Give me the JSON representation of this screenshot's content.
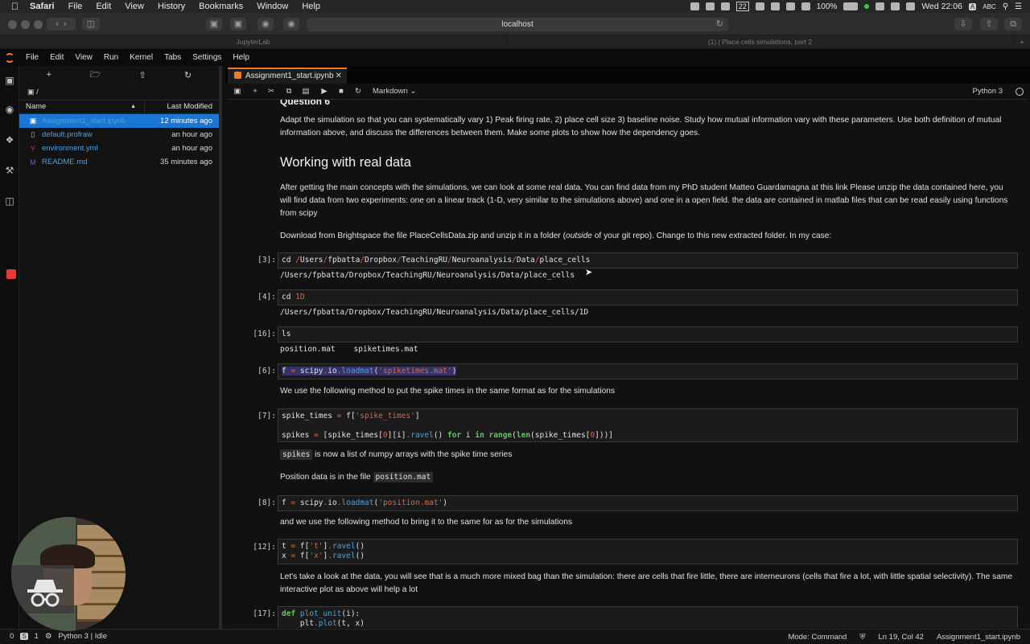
{
  "menubar": {
    "apple": "",
    "app": "Safari",
    "items": [
      "File",
      "Edit",
      "View",
      "History",
      "Bookmarks",
      "Window",
      "Help"
    ],
    "battery": "100%",
    "input_source": "ABC",
    "clock": "Wed 22:06",
    "calendar_day": "22"
  },
  "safari": {
    "address": "localhost",
    "tabs": [
      "JupyterLab",
      "(1) | Place cells simulations, part 2"
    ]
  },
  "jupyter_menu": [
    "File",
    "Edit",
    "View",
    "Run",
    "Kernel",
    "Tabs",
    "Settings",
    "Help"
  ],
  "file_browser": {
    "breadcrumb": "/",
    "col_name": "Name",
    "col_modified": "Last Modified",
    "files": [
      {
        "name": "Assignment1_start.ipynb",
        "modified": "12 minutes ago",
        "icon": "notebook-icon",
        "selected": true
      },
      {
        "name": "default.profraw",
        "modified": "an hour ago",
        "icon": "file-icon",
        "selected": false
      },
      {
        "name": "environment.yml",
        "modified": "an hour ago",
        "icon": "yaml-icon",
        "selected": false
      },
      {
        "name": "README.md",
        "modified": "35 minutes ago",
        "icon": "markdown-icon",
        "selected": false
      }
    ]
  },
  "notebook": {
    "tab_title": "Assignment1_start.ipynb",
    "cell_type": "Markdown",
    "kernel": "Python 3",
    "q6_heading": "Question 6",
    "q6_text": "Adapt the simulation so that you can systematically vary 1) Peak firing rate, 2) place cell size 3) baseline noise. Study how mutual information vary with these parameters. Use both definition of mutual information above, and discuss the differences between them. Make some plots to show how the dependency goes.",
    "real_heading": "Working with real data",
    "real_text": "After getting the main concepts with the simulations, we can look at some real data. You can find data from my PhD student Matteo Guardamagna at this link Please unzip the data contained here, you will find data from two experiments: one on a linear track (1-D, very similar to the simulations above) and one in a open field. the data are contained in matlab files that can be read easily using functions from scipy",
    "download_text_1": "Download from Brightspace the file PlaceCellsData.zip and unzip it in a folder (",
    "download_text_em": "outside",
    "download_text_2": " of your git repo). Change to this new extracted folder. In my case:",
    "cell3_prompt": "[3]:",
    "cell3_out": "/Users/fpbatta/Dropbox/TeachingRU/Neuroanalysis/Data/place_cells",
    "cell4_prompt": "[4]:",
    "cell4_out": "/Users/fpbatta/Dropbox/TeachingRU/Neuroanalysis/Data/place_cells/1D",
    "cell16_prompt": "[16]:",
    "cell16_code": "ls",
    "cell16_out": "position.mat    spiketimes.mat",
    "cell6_prompt": "[6]:",
    "method_text": "We use the following method to put the spike times in the same format as for the simulations",
    "cell7_prompt": "[7]:",
    "spikes_inline": "spikes",
    "spikes_text": " is now a list of numpy arrays with the spike time series",
    "position_text": "Position data is in the file ",
    "position_inline": "position.mat",
    "cell8_prompt": "[8]:",
    "bring_text": "and we use the following method to bring it to the same for as for the simulations",
    "cell12_prompt": "[12]:",
    "mixed_text": "Let's take a look at the data, you will see that is a much more mixed bag than the simulation: there are cells that fire little, there are interneurons (cells that fire a lot, with little spatial selectivity). The same interactive plot as above will help a lot",
    "cell17_prompt": "[17]:"
  },
  "status": {
    "left_count_1": "0",
    "left_count_2": "1",
    "kernel_state": "Python 3 | Idle",
    "mode": "Mode: Command",
    "position": "Ln 19, Col 42",
    "file": "Assignment1_start.ipynb"
  }
}
